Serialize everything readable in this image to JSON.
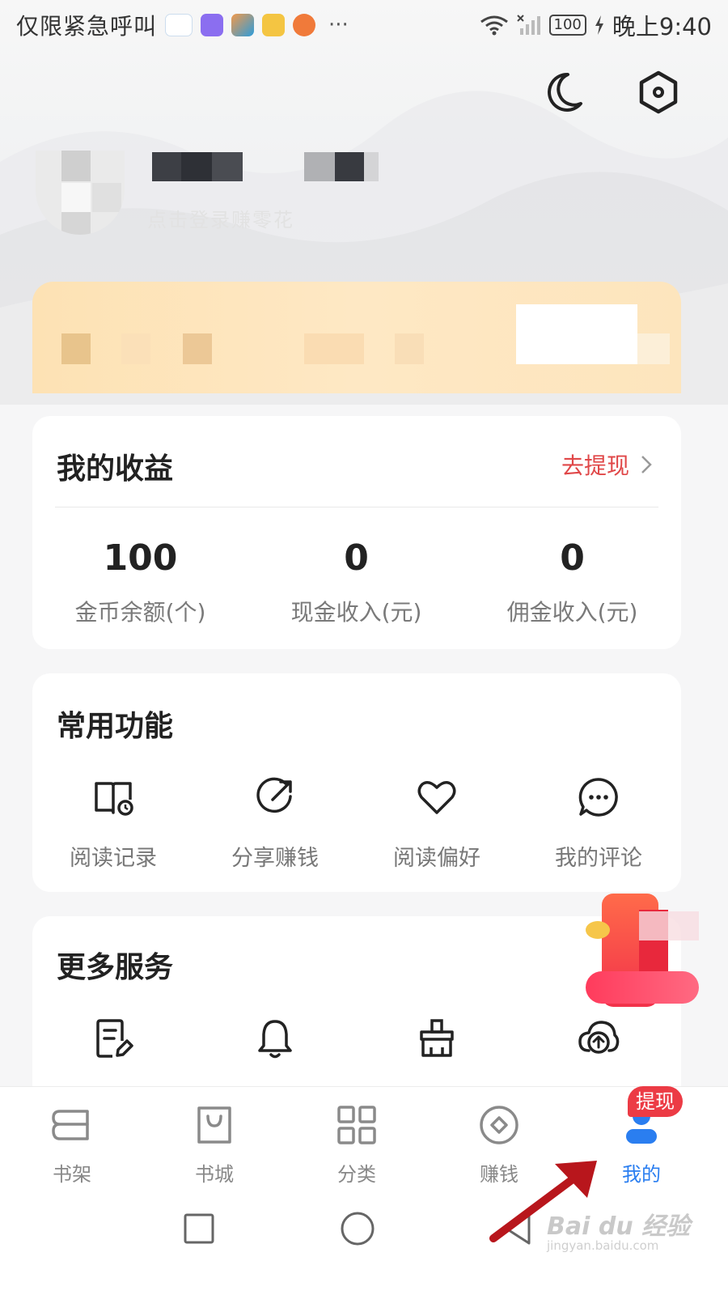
{
  "status_bar": {
    "carrier": "仅限紧急呼叫",
    "more": "···",
    "battery": "100",
    "time": "晚上9:40"
  },
  "header": {
    "night_mode_icon": "moon-icon",
    "settings_icon": "hexagon-settings-icon",
    "profile_subtitle": "点击登录赚零花"
  },
  "earnings": {
    "title": "我的收益",
    "withdraw_label": "去提现",
    "stats": [
      {
        "value": "100",
        "label": "金币余额(个)"
      },
      {
        "value": "0",
        "label": "现金收入(元)"
      },
      {
        "value": "0",
        "label": "佣金收入(元)"
      }
    ]
  },
  "common_features": {
    "title": "常用功能",
    "items": [
      {
        "label": "阅读记录",
        "icon": "book-history-icon"
      },
      {
        "label": "分享赚钱",
        "icon": "share-icon"
      },
      {
        "label": "阅读偏好",
        "icon": "heart-icon"
      },
      {
        "label": "我的评论",
        "icon": "comment-icon"
      }
    ]
  },
  "more_services": {
    "title": "更多服务",
    "items": [
      {
        "icon": "document-edit-icon"
      },
      {
        "icon": "bell-icon"
      },
      {
        "icon": "broom-icon"
      },
      {
        "icon": "cloud-upload-icon"
      }
    ]
  },
  "tabbar": {
    "items": [
      {
        "label": "书架",
        "icon": "bookshelf-icon"
      },
      {
        "label": "书城",
        "icon": "shopping-bag-icon"
      },
      {
        "label": "分类",
        "icon": "grid-icon"
      },
      {
        "label": "赚钱",
        "icon": "coin-icon"
      },
      {
        "label": "我的",
        "icon": "profile-icon"
      }
    ],
    "active": "我的",
    "badge": "提现"
  },
  "watermark": {
    "brand": "Bai du 经验",
    "url": "jingyan.baidu.com"
  },
  "colors": {
    "accent_blue": "#2a7ef0",
    "withdraw_red": "#e04748",
    "badge_red": "#ec3b45",
    "arrow_red": "#b8161c"
  }
}
